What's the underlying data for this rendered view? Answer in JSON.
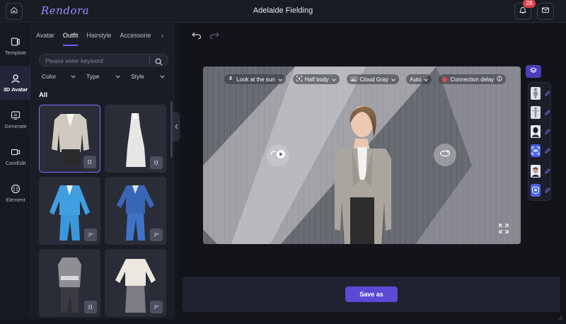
{
  "app": {
    "logo": "Rendora",
    "title": "Adelaide Fielding",
    "notification_count": "28"
  },
  "rail": {
    "items": [
      {
        "label": "Template",
        "icon": "template-icon"
      },
      {
        "label": "3D Avatar",
        "icon": "avatar-icon",
        "active": true
      },
      {
        "label": "Generate",
        "icon": "ai-icon"
      },
      {
        "label": "CamEdit",
        "icon": "camera-icon"
      },
      {
        "label": "Element",
        "icon": "element-icon"
      }
    ]
  },
  "panel": {
    "tabs": [
      {
        "label": "Avatar"
      },
      {
        "label": "Outfit",
        "active": true
      },
      {
        "label": "Hairstyle"
      },
      {
        "label": "Accessorie"
      }
    ],
    "search": {
      "placeholder": "Please enter keyword",
      "value": ""
    },
    "filters": [
      {
        "label": "Color"
      },
      {
        "label": "Type"
      },
      {
        "label": "Style"
      }
    ],
    "section_title": "All",
    "outfits": [
      {
        "name": "grey blazer with black skirt",
        "selected": true
      },
      {
        "name": "white sleeveless dress"
      },
      {
        "name": "light blue suit"
      },
      {
        "name": "blue suit"
      },
      {
        "name": "grey belted outfit"
      },
      {
        "name": "cream jacket with grey skirt"
      }
    ]
  },
  "viewer": {
    "toolbar": [
      {
        "label": "Look at the sun",
        "icon": "pose-icon"
      },
      {
        "label": "Half body",
        "icon": "framing-icon"
      },
      {
        "label": "Cloud Gray",
        "icon": "background-icon"
      },
      {
        "label": "Auto",
        "icon": ""
      },
      {
        "label": "Connection delay",
        "icon": "status-dot"
      }
    ]
  },
  "right_panel": {
    "items": [
      "full-body-icon",
      "t-pose-icon",
      "head-icon",
      "face-scan-icon",
      "portrait-icon",
      "face-shield-icon"
    ]
  },
  "footer": {
    "save_label": "Save as"
  },
  "colors": {
    "accent": "#6b5cff",
    "button": "#5b4ad6",
    "badge": "#e0424b",
    "status_red": "#e5484d"
  }
}
